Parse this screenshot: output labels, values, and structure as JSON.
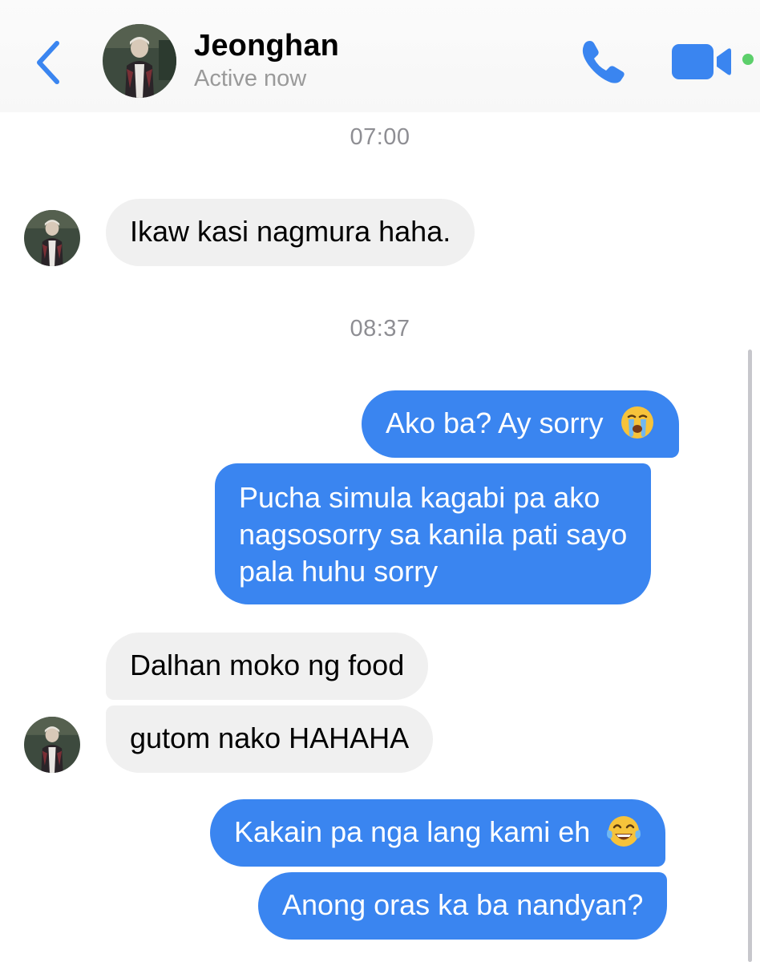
{
  "header": {
    "contact_name": "Jeonghan",
    "status": "Active now",
    "back_icon": "chevron-left-icon",
    "call_icon": "phone-icon",
    "video_icon": "video-camera-icon",
    "accent_color": "#3a85f0",
    "online_color": "#5ccf6b"
  },
  "thread": {
    "timestamps": [
      "07:00",
      "08:37"
    ],
    "messages": [
      {
        "sender": "contact",
        "text": "Ikaw kasi nagmura haha."
      },
      {
        "sender": "me",
        "text": "Ako ba? Ay sorry",
        "emoji": "loudly-crying-face-icon"
      },
      {
        "sender": "me",
        "lines": [
          "Pucha simula kagabi pa ako",
          "nagsosorry sa kanila pati sayo",
          "pala huhu sorry"
        ]
      },
      {
        "sender": "contact",
        "text": "Dalhan moko ng food"
      },
      {
        "sender": "contact",
        "text": "gutom nako HAHAHA"
      },
      {
        "sender": "me",
        "text": "Kakain pa nga lang kami eh",
        "emoji": "tears-of-joy-icon"
      },
      {
        "sender": "me",
        "text": "Anong oras ka ba nandyan?"
      }
    ],
    "colors": {
      "incoming_bubble": "#f0f0f0",
      "outgoing_bubble": "#3a85f0"
    }
  }
}
